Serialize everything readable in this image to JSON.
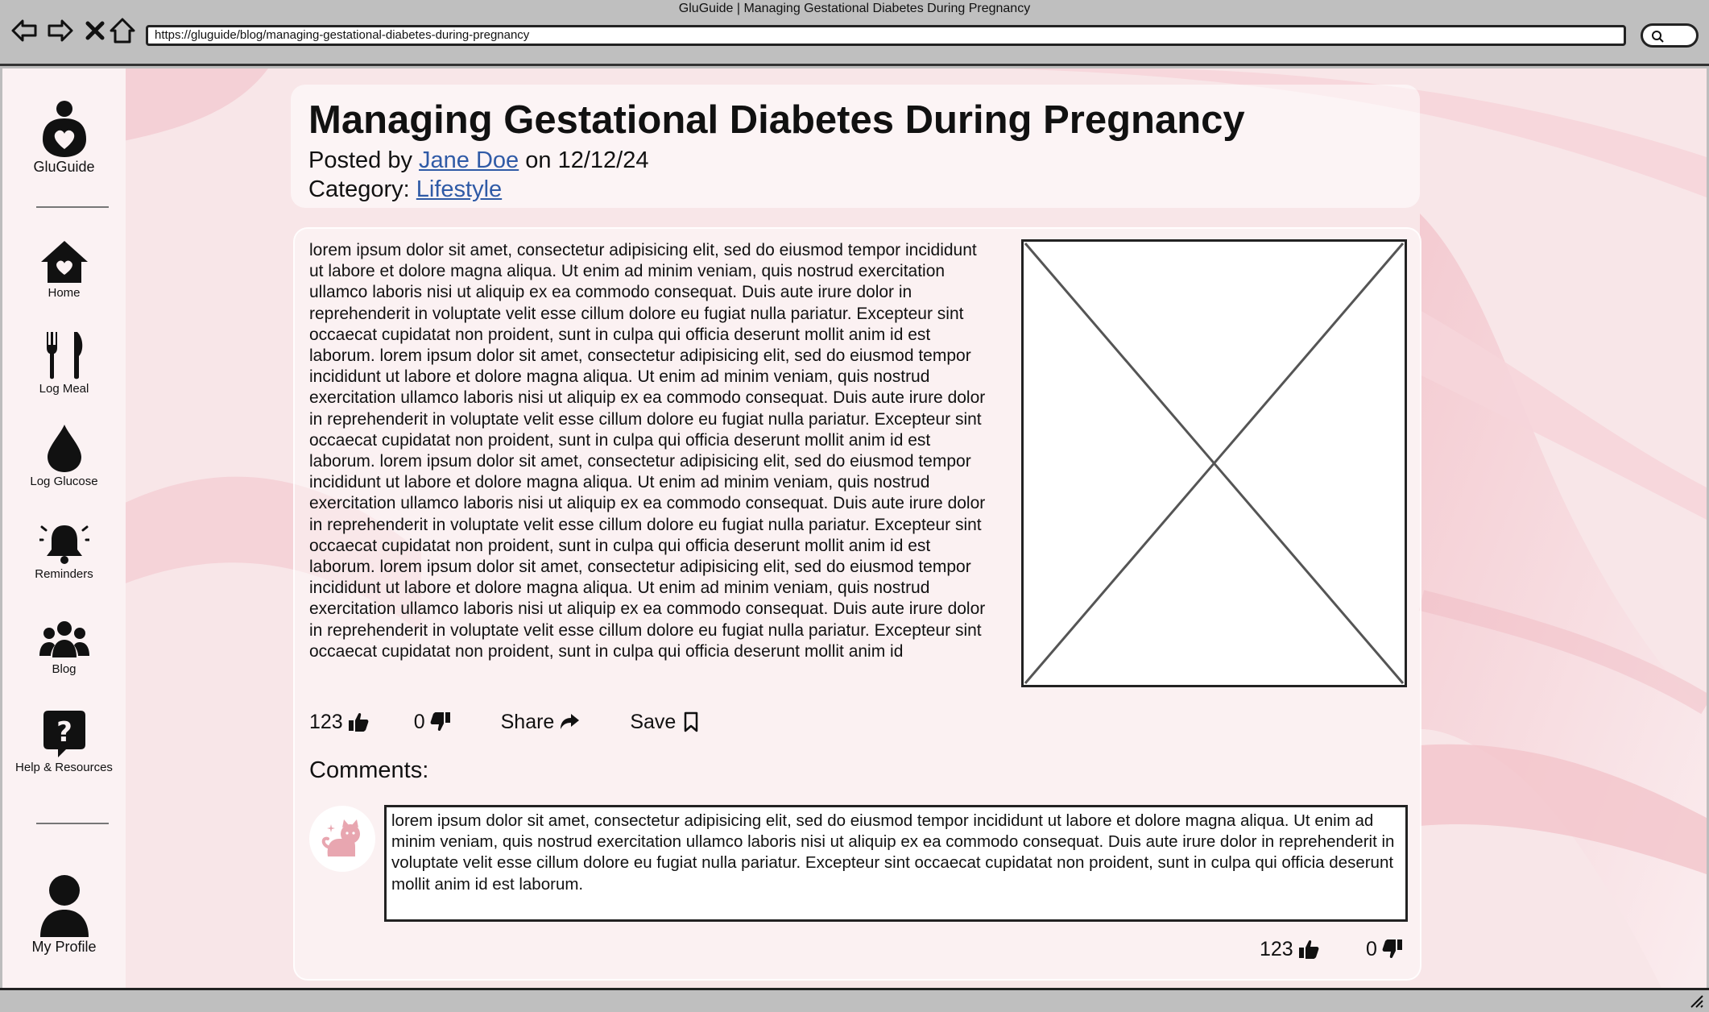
{
  "browser": {
    "window_title": "GluGuide | Managing Gestational Diabetes During Pregnancy",
    "url": "https://gluguide/blog/managing-gestational-diabetes-during-pregnancy",
    "icons": [
      "back-arrow-icon",
      "forward-arrow-icon",
      "close-x-icon",
      "home-icon",
      "search-icon"
    ]
  },
  "sidebar": {
    "logo_label": "GluGuide",
    "items": [
      {
        "label": "Home",
        "icon": "home-heart-icon"
      },
      {
        "label": "Log Meal",
        "icon": "fork-knife-icon"
      },
      {
        "label": "Log Glucose",
        "icon": "drop-icon"
      },
      {
        "label": "Reminders",
        "icon": "bell-icon"
      },
      {
        "label": "Blog",
        "icon": "people-icon"
      },
      {
        "label": "Help & Resources",
        "icon": "question-bubble-icon"
      }
    ],
    "profile_label": "My Profile"
  },
  "post": {
    "title": "Managing Gestational Diabetes During Pregnancy",
    "posted_by_prefix": "Posted by",
    "author": "Jane Doe",
    "date_prefix": "on",
    "date": "12/12/24",
    "category_prefix": "Category:",
    "category": "Lifestyle",
    "body": "lorem ipsum dolor sit amet, consectetur adipisicing elit, sed do eiusmod tempor incididunt ut labore et dolore magna aliqua. Ut enim ad minim veniam, quis nostrud exercitation ullamco laboris nisi ut aliquip ex ea commodo consequat. Duis aute irure dolor in reprehenderit in voluptate velit esse cillum dolore eu fugiat nulla pariatur. Excepteur sint occaecat cupidatat non proident, sunt in culpa qui officia deserunt mollit anim id est laborum. lorem ipsum dolor sit amet, consectetur adipisicing elit, sed do eiusmod tempor incididunt ut labore et dolore magna aliqua. Ut enim ad minim veniam, quis nostrud exercitation ullamco laboris nisi ut aliquip ex ea commodo consequat. Duis aute irure dolor in reprehenderit in voluptate velit esse cillum dolore eu fugiat nulla pariatur. Excepteur sint occaecat cupidatat non proident, sunt in culpa qui officia deserunt mollit anim id est laborum. lorem ipsum dolor sit amet, consectetur adipisicing elit, sed do eiusmod tempor incididunt ut labore et dolore magna aliqua. Ut enim ad minim veniam, quis nostrud exercitation ullamco laboris nisi ut aliquip ex ea commodo consequat. Duis aute irure dolor in reprehenderit in voluptate velit esse cillum dolore eu fugiat nulla pariatur. Excepteur sint occaecat cupidatat non proident, sunt in culpa qui officia deserunt mollit anim id est laborum. lorem ipsum dolor sit amet, consectetur adipisicing elit, sed do eiusmod tempor incididunt ut labore et dolore magna aliqua. Ut enim ad minim veniam, quis nostrud exercitation ullamco laboris nisi ut aliquip ex ea commodo consequat. Duis aute irure dolor in reprehenderit in voluptate velit esse cillum dolore eu fugiat nulla pariatur. Excepteur sint occaecat cupidatat non proident, sunt in culpa qui officia deserunt mollit anim id",
    "likes": "123",
    "dislikes": "0",
    "share_label": "Share",
    "save_label": "Save"
  },
  "comments": {
    "heading": "Comments:",
    "items": [
      {
        "text": "lorem ipsum dolor sit amet, consectetur adipisicing elit, sed do eiusmod tempor incididunt ut labore et dolore magna aliqua. Ut enim ad minim veniam, quis nostrud exercitation ullamco laboris nisi ut aliquip ex ea commodo consequat. Duis aute irure dolor in reprehenderit in voluptate velit esse cillum dolore eu fugiat nulla pariatur. Excepteur sint occaecat cupidatat non proident, sunt in culpa qui officia deserunt mollit anim id est laborum.",
        "likes": "123",
        "dislikes": "0",
        "avatar_icon": "cat-avatar-icon"
      }
    ]
  },
  "colors": {
    "background_pink": "#f8e6e8",
    "accent_pink": "#e8a6b0",
    "link_blue": "#2f5aa6",
    "chrome_gray": "#bfbfbf"
  }
}
